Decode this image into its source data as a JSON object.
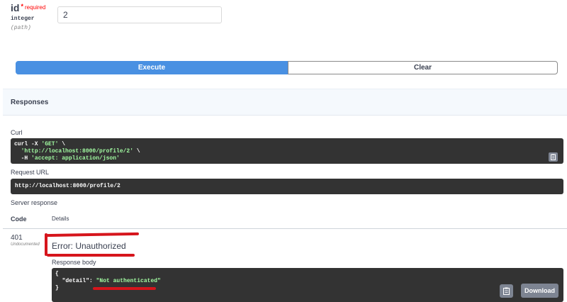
{
  "param": {
    "name": "id",
    "required_star": "*",
    "required_label": "required",
    "type": "integer",
    "location": "(path)",
    "value": "2"
  },
  "buttons": {
    "execute": "Execute",
    "clear": "Clear"
  },
  "responses": {
    "title": "Responses",
    "curl_label": "Curl",
    "curl_lines": {
      "l1_prefix": "curl -X ",
      "l1_str": "'GET'",
      "l1_suffix": " \\",
      "l2_str": "'http://localhost:8000/profile/2'",
      "l2_suffix": " \\",
      "l3_prefix": "-H ",
      "l3_str": "'accept: application/json'"
    },
    "request_url_label": "Request URL",
    "request_url": "http://localhost:8000/profile/2",
    "server_response_label": "Server response",
    "col_code": "Code",
    "col_details": "Details",
    "status_code": "401",
    "status_undocumented": "Undocumented",
    "error_text": "Error: Unauthorized",
    "response_body_label": "Response body",
    "body": {
      "open": "{",
      "key": "\"detail\"",
      "colon": ": ",
      "value": "\"Not authenticated\"",
      "close": "}"
    },
    "download_label": "Download"
  },
  "colors": {
    "execute_blue": "#4990e2",
    "code_bg": "#333333",
    "string_green": "#a2fca2",
    "annotation_red": "#d6151c",
    "required_red": "#ff0000"
  }
}
